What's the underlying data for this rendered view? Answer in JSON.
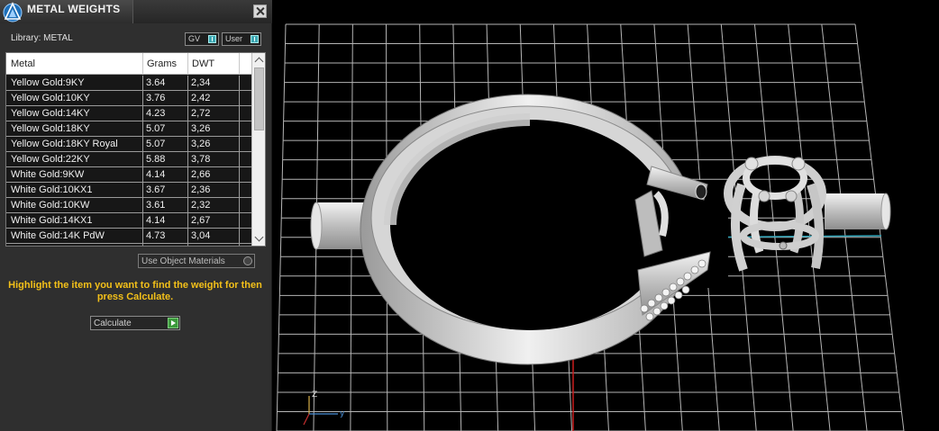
{
  "panel": {
    "title": "METAL WEIGHTS",
    "library_label": "Library: METAL",
    "toggles": {
      "gv": "GV",
      "user": "User"
    },
    "columns": {
      "metal": "Metal",
      "grams": "Grams",
      "dwt": "DWT"
    },
    "rows": [
      {
        "metal": "Yellow Gold:9KY",
        "grams": "3.64",
        "dwt": "2,34"
      },
      {
        "metal": "Yellow Gold:10KY",
        "grams": "3.76",
        "dwt": "2,42"
      },
      {
        "metal": "Yellow Gold:14KY",
        "grams": "4.23",
        "dwt": "2,72"
      },
      {
        "metal": "Yellow Gold:18KY",
        "grams": "5.07",
        "dwt": "3,26"
      },
      {
        "metal": "Yellow Gold:18KY Royal",
        "grams": "5.07",
        "dwt": "3,26"
      },
      {
        "metal": "Yellow Gold:22KY",
        "grams": "5.88",
        "dwt": "3,78"
      },
      {
        "metal": "White Gold:9KW",
        "grams": "4.14",
        "dwt": "2,66"
      },
      {
        "metal": "White Gold:10KX1",
        "grams": "3.67",
        "dwt": "2,36"
      },
      {
        "metal": "White Gold:10KW",
        "grams": "3.61",
        "dwt": "2,32"
      },
      {
        "metal": "White Gold:14KX1",
        "grams": "4.14",
        "dwt": "2,67"
      },
      {
        "metal": "White Gold:14K PdW",
        "grams": "4.73",
        "dwt": "3,04"
      }
    ],
    "use_object_materials": "Use Object Materials",
    "hint": "Highlight the item you want to find the weight for then press Calculate.",
    "calculate_label": "Calculate"
  },
  "viewport": {
    "axis_z": "Z",
    "axis_y": "y",
    "colors": {
      "grid": "#b5b5b5",
      "x_axis": "#c81e1e",
      "y_axis": "#2fa4b8",
      "model": "#d8d8d8"
    }
  }
}
